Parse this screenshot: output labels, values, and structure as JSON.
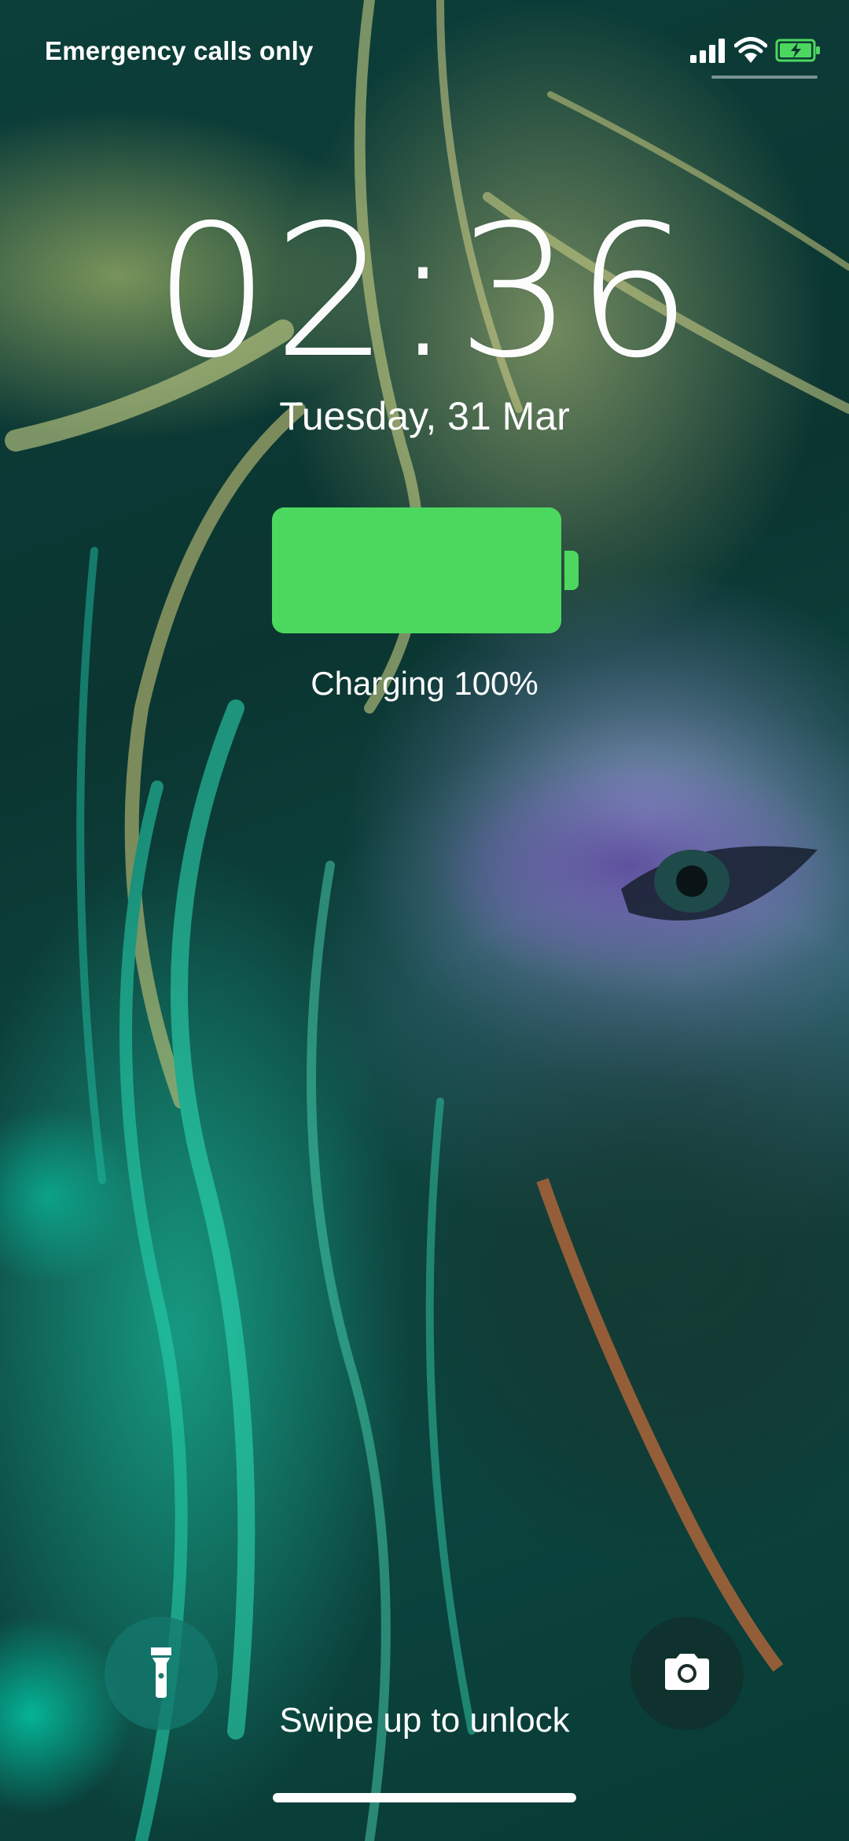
{
  "status_bar": {
    "carrier_text": "Emergency calls only",
    "icons": [
      "signal-icon",
      "wifi-icon",
      "battery-charging-icon"
    ]
  },
  "lock_screen": {
    "time": "02:36",
    "date": "Tuesday, 31 Mar",
    "battery_level": 1.0,
    "charging_text": "Charging 100%",
    "unlock_hint": "Swipe up to unlock",
    "shortcuts": [
      "flashlight-icon",
      "camera-icon"
    ]
  },
  "colors": {
    "battery_green": "#4cd85f",
    "text": "#ffffff",
    "wallpaper_teal": "#0c3f3a"
  }
}
